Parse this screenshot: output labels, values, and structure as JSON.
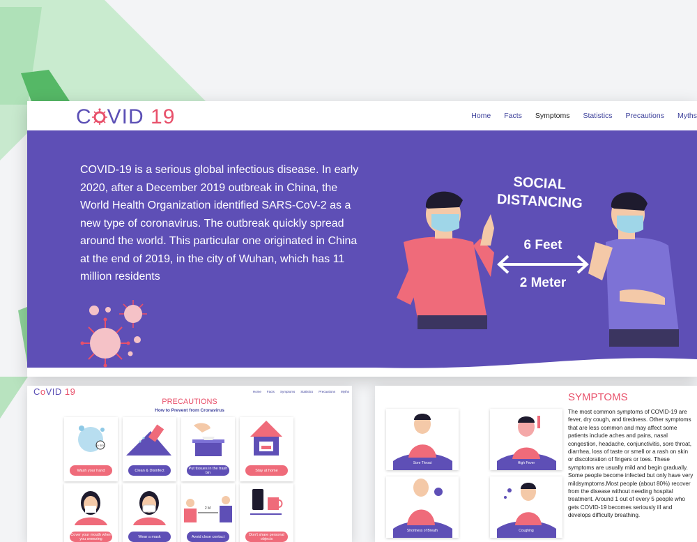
{
  "main": {
    "logo": {
      "part1": "C",
      "part2": "VID",
      "part3": "19"
    },
    "nav": [
      {
        "label": "Home"
      },
      {
        "label": "Facts"
      },
      {
        "label": "Symptoms"
      },
      {
        "label": "Statistics"
      },
      {
        "label": "Precautions"
      },
      {
        "label": "Myths"
      }
    ],
    "hero_text": "COVID-19 is a serious global infectious disease. In early 2020, after a December 2019 outbreak in China, the World Health Organization identified SARS-CoV-2 as a new type of coronavirus. The outbreak quickly spread around the world. This particular one originated in China at the end of 2019, in the city of Wuhan, which has 11 million residents",
    "illustration": {
      "line1": "SOCIAL",
      "line2": "DISTANCING",
      "feet": "6 Feet",
      "meter": "2 Meter"
    }
  },
  "precautions": {
    "logo": {
      "part1": "C",
      "part2": "VID",
      "part3": "19"
    },
    "nav": [
      "Home",
      "Facts",
      "Symptoms",
      "Statistics",
      "Precautions",
      "Myths"
    ],
    "title": "PRECAUTIONS",
    "subtitle": "How to Prevent from Cronavirus",
    "cards": [
      {
        "label": "Wash your hand",
        "color": "pink"
      },
      {
        "label": "Clean & Disinfect",
        "color": "purple"
      },
      {
        "label": "Put tissues in the trash bin",
        "color": "purple"
      },
      {
        "label": "Stay at home",
        "color": "pink"
      },
      {
        "label": "Cover your mouth when you sneezing",
        "color": "pink"
      },
      {
        "label": "Wear a mask",
        "color": "purple"
      },
      {
        "label": "Avoid close contact",
        "color": "purple"
      },
      {
        "label": "Don't share personal objects",
        "color": "pink"
      }
    ],
    "wash_timer": "20 SEC",
    "distance_label": "2 M"
  },
  "symptoms": {
    "title": "SYMPTOMS",
    "text": "The most common symptoms of COVID-19 are fever, dry cough, and tiredness. Other symptoms that are less common and may affect some patients include aches and pains, nasal congestion, headache, conjunctivitis, sore throat, diarrhea, loss of taste or smell or a rash on skin or discoloration of fingers or toes. These symptoms are usually mild and begin gradually. Some people become infected but only have very mildsymptoms.Most people (about 80%) recover from the disease without needing hospital treatment. Around 1 out of every 5 people who gets COVID-19 becomes seriously ill and develops difficulty breathing.",
    "cards": [
      {
        "label": "Sore Throat"
      },
      {
        "label": "High Fever"
      },
      {
        "label": "Shortness of Breath"
      },
      {
        "label": "Coughing"
      }
    ]
  },
  "colors": {
    "brand_purple": "#5e4fb6",
    "brand_pink": "#e8506a",
    "nav_link": "#3b3f9a",
    "bg_green": "#6cc476"
  }
}
